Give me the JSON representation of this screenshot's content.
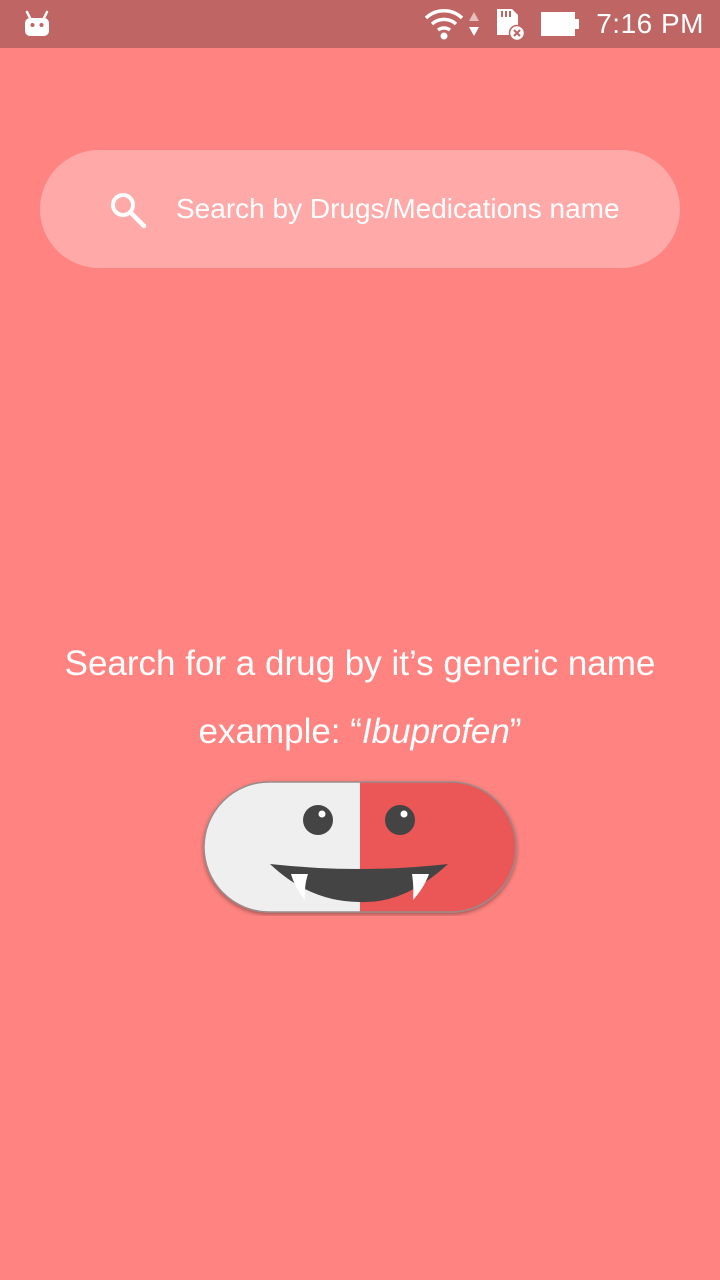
{
  "status_bar": {
    "time": "7:16 PM",
    "icons": [
      "android-icon",
      "wifi-icon",
      "data-arrows-icon",
      "sd-card-icon",
      "battery-icon"
    ]
  },
  "search": {
    "placeholder": "Search by Drugs/Medications name",
    "value": "",
    "icon": "search-icon"
  },
  "empty_state": {
    "line1": "Search for a drug by it’s generic name",
    "example_prefix": "example: ",
    "example_open_quote": "“",
    "example_term": "Ibuprofen",
    "example_close_quote": "”",
    "illustration": "pill-mascot-icon"
  },
  "colors": {
    "background": "#FF8481",
    "status_bar": "#BF6563",
    "search_box": "#FFA9A8",
    "pill_left": "#EFEFEF",
    "pill_right": "#EB5756",
    "face": "#444444"
  }
}
